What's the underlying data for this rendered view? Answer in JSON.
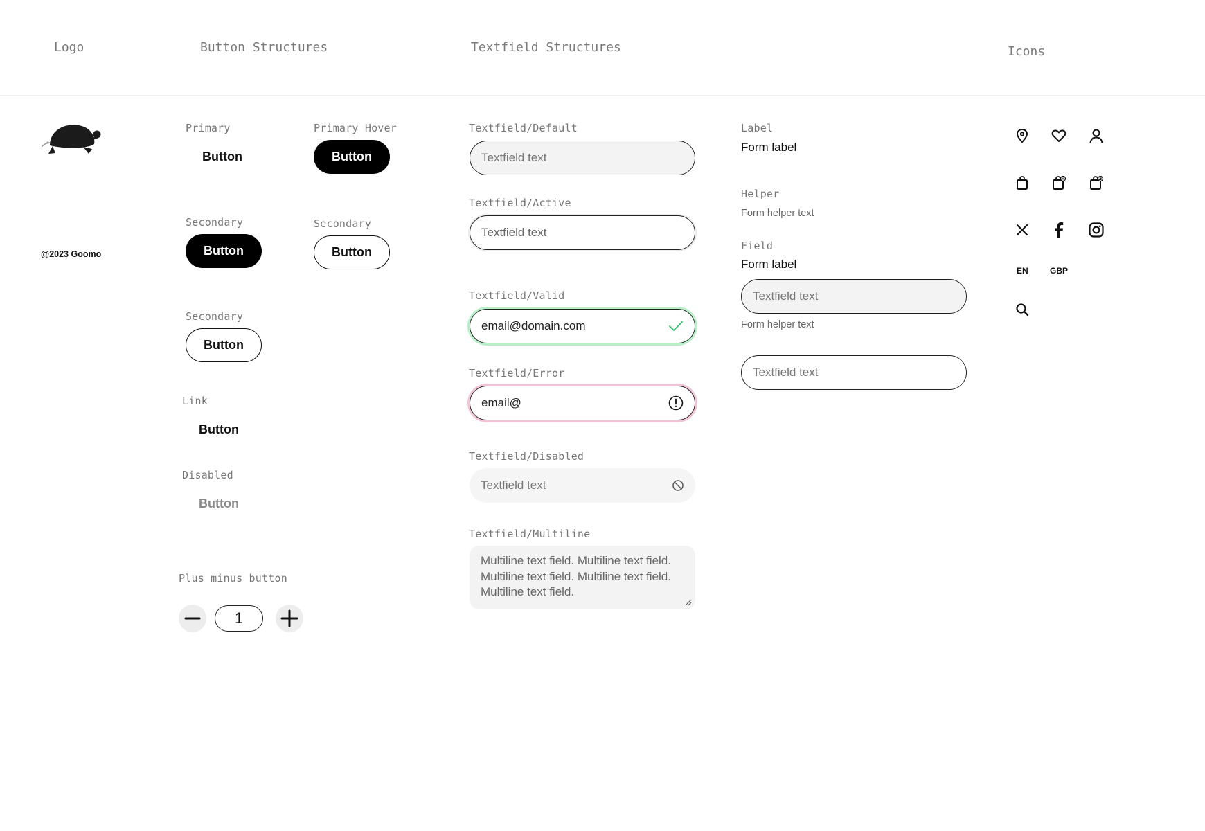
{
  "headers": {
    "logo": "Logo",
    "buttons": "Button Structures",
    "textfields": "Textfield Structures",
    "icons": "Icons"
  },
  "logo": {
    "copyright": "@2023 Goomo"
  },
  "buttons": {
    "primary": {
      "label": "Primary",
      "text": "Button"
    },
    "primary_hover": {
      "label": "Primary Hover",
      "text": "Button"
    },
    "secondary_dark": {
      "label": "Secondary",
      "text": "Button"
    },
    "secondary_outline_b": {
      "label": "Secondary",
      "text": "Button"
    },
    "secondary_outline_a": {
      "label": "Secondary",
      "text": "Button"
    },
    "link": {
      "label": "Link",
      "text": "Button"
    },
    "disabled": {
      "label": "Disabled",
      "text": "Button"
    },
    "plus_minus": {
      "label": "Plus minus button",
      "value": "1"
    }
  },
  "textfields": {
    "default": {
      "label": "Textfield/Default",
      "text": "Textfield text"
    },
    "active": {
      "label": "Textfield/Active",
      "text": "Textfield text"
    },
    "valid": {
      "label": "Textfield/Valid",
      "text": "email@domain.com",
      "status_color": "#2fbf6a"
    },
    "error": {
      "label": "Textfield/Error",
      "text": "email@"
    },
    "disabled": {
      "label": "Textfield/Disabled",
      "text": "Textfield text"
    },
    "multiline": {
      "label": "Textfield/Multiline",
      "text": "Multiline text field. Multiline text field. Multiline text field. Multiline text field. Multiline text field."
    }
  },
  "form": {
    "label": {
      "title": "Label",
      "text": "Form label"
    },
    "helper": {
      "title": "Helper",
      "text": "Form helper text"
    },
    "field": {
      "title": "Field",
      "label": "Form label",
      "input_text": "Textfield text",
      "helper": "Form helper text",
      "input2_text": "Textfield text"
    }
  },
  "icons": {
    "row1": [
      "location-pin-icon",
      "heart-icon",
      "user-icon"
    ],
    "row2": [
      "shopping-bag-icon",
      "bag-badge-icon",
      "bag-badge-alt-icon"
    ],
    "row3": [
      "close-icon",
      "facebook-icon",
      "instagram-icon"
    ],
    "language": "EN",
    "currency": "GBP",
    "search": "search-icon"
  }
}
